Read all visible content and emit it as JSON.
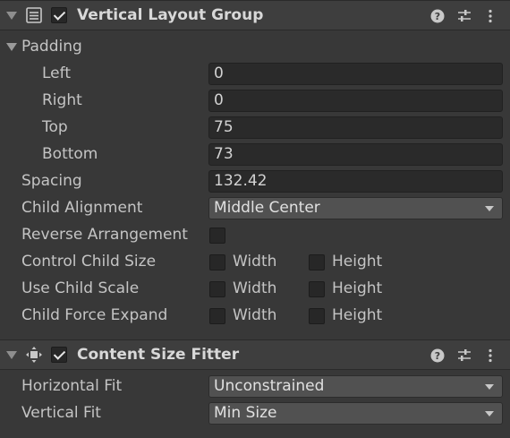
{
  "vertical_layout_group": {
    "title": "Vertical Layout Group",
    "enabled": true,
    "header_icon": "list-icon",
    "header_buttons": [
      "help-icon",
      "presets-icon",
      "more-icon"
    ],
    "padding": {
      "label": "Padding",
      "left": {
        "label": "Left",
        "value": "0"
      },
      "right": {
        "label": "Right",
        "value": "0"
      },
      "top": {
        "label": "Top",
        "value": "75"
      },
      "bottom": {
        "label": "Bottom",
        "value": "73"
      }
    },
    "spacing": {
      "label": "Spacing",
      "value": "132.42"
    },
    "child_alignment": {
      "label": "Child Alignment",
      "value": "Middle Center"
    },
    "reverse_arrangement": {
      "label": "Reverse Arrangement",
      "checked": false
    },
    "control_child_size": {
      "label": "Control Child Size",
      "width_label": "Width",
      "height_label": "Height",
      "width": false,
      "height": false
    },
    "use_child_scale": {
      "label": "Use Child Scale",
      "width_label": "Width",
      "height_label": "Height",
      "width": false,
      "height": false
    },
    "child_force_expand": {
      "label": "Child Force Expand",
      "width_label": "Width",
      "height_label": "Height",
      "width": false,
      "height": false
    }
  },
  "content_size_fitter": {
    "title": "Content Size Fitter",
    "enabled": true,
    "header_icon": "content-size-fitter-icon",
    "header_buttons": [
      "help-icon",
      "presets-icon",
      "more-icon"
    ],
    "horizontal_fit": {
      "label": "Horizontal Fit",
      "value": "Unconstrained"
    },
    "vertical_fit": {
      "label": "Vertical Fit",
      "value": "Min Size"
    }
  },
  "colors": {
    "background": "#383838",
    "header": "#3e3e3e",
    "field": "#2a2a2a",
    "dropdown": "#515151",
    "text": "#c4c4c4"
  }
}
